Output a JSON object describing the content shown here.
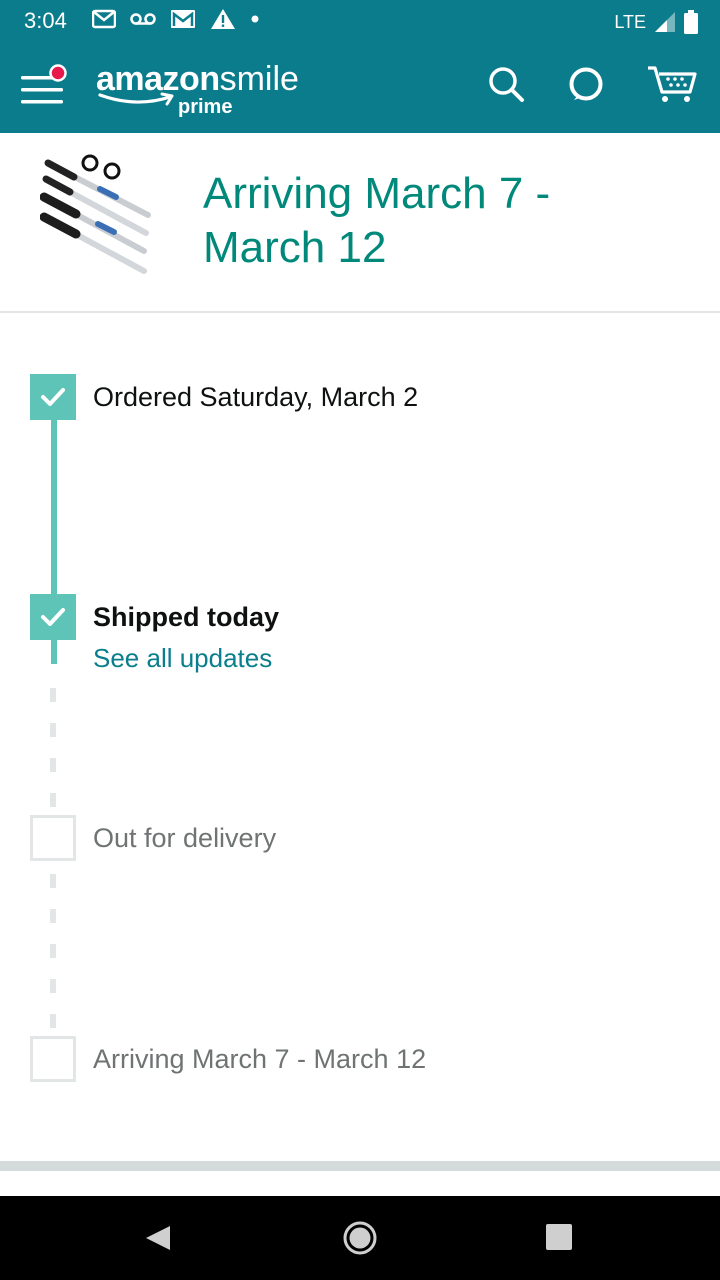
{
  "status_bar": {
    "time": "3:04",
    "network": "LTE"
  },
  "app_bar": {
    "logo_main": "amazon",
    "logo_suffix": "smile",
    "logo_sub": "prime",
    "icons": [
      "menu-icon",
      "search-icon",
      "alexa-icon",
      "cart-icon"
    ],
    "accent_color": "#0b7c8c"
  },
  "header": {
    "title": "Arriving March 7 - March 12"
  },
  "timeline": {
    "steps": [
      {
        "label": "Ordered Saturday, March 2",
        "done": true
      },
      {
        "label": "Shipped today",
        "done": true,
        "link": "See all updates"
      },
      {
        "label": "Out for delivery",
        "done": false
      },
      {
        "label": "Arriving March 7 - March 12",
        "done": false
      }
    ],
    "done_color": "#5ec4b7",
    "pending_color": "#e3e6e6"
  }
}
